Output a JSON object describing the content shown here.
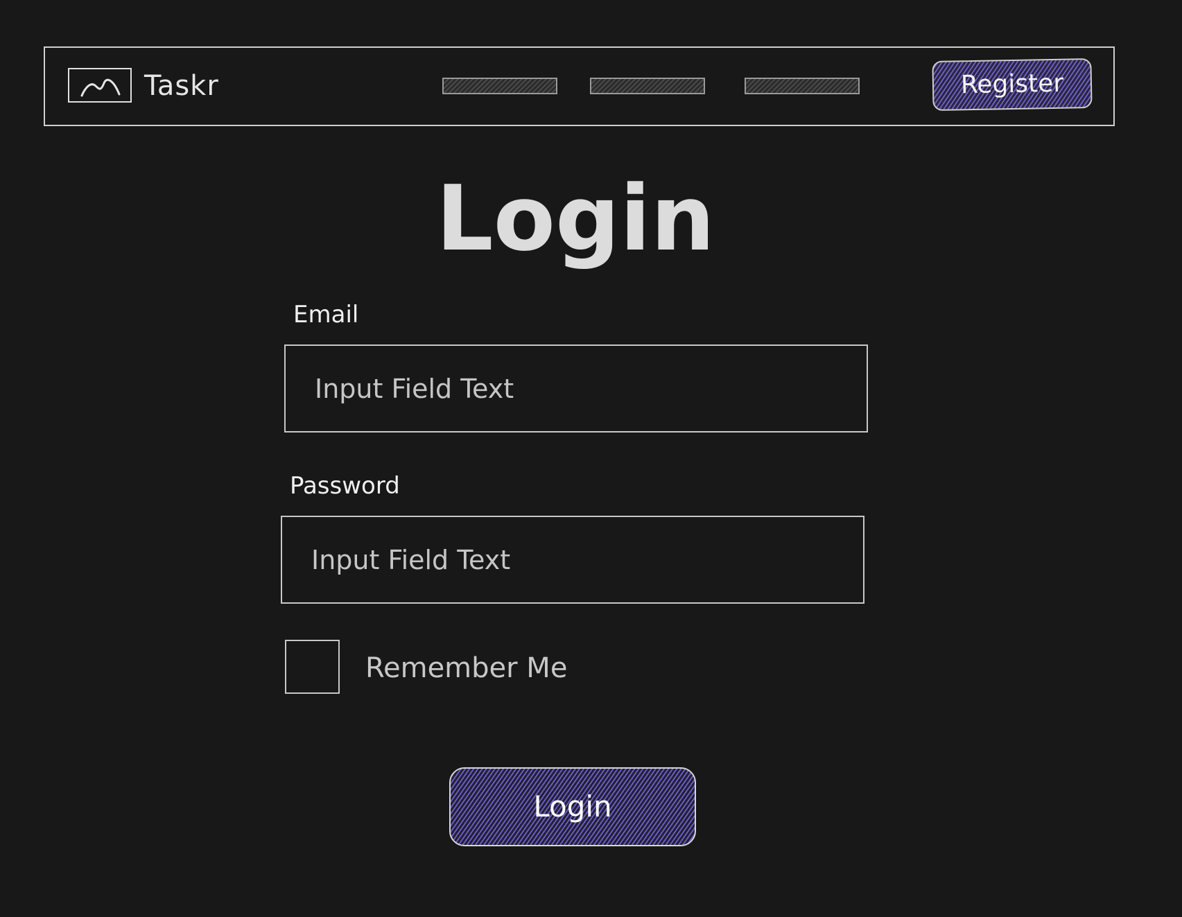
{
  "navbar": {
    "brand": "Taskr",
    "logo_icon": "image-placeholder-icon",
    "nav_links": [
      "",
      "",
      ""
    ],
    "register_label": "Register"
  },
  "main": {
    "title": "Login",
    "email": {
      "label": "Email",
      "placeholder": "Input Field Text"
    },
    "password": {
      "label": "Password",
      "placeholder": "Input Field Text"
    },
    "remember_me": {
      "label": "Remember Me",
      "checked": false
    },
    "submit_label": "Login"
  },
  "colors": {
    "background": "#181818",
    "accent": "#6a5cc0",
    "stroke": "#cfcfcf"
  }
}
